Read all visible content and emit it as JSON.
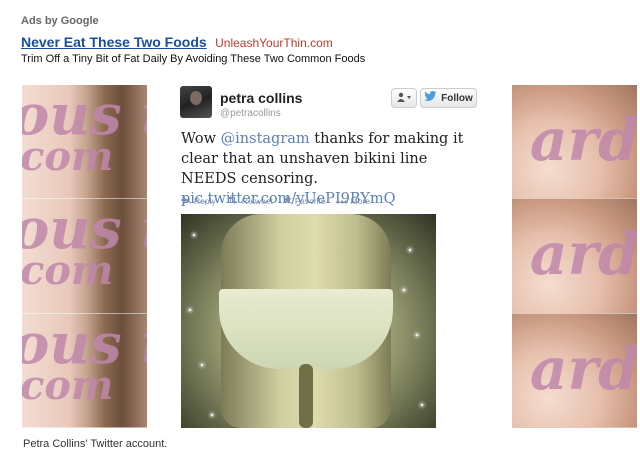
{
  "ad": {
    "label": "Ads by Google",
    "title": "Never Eat These Two Foods",
    "url": "UnleashYourThin.com",
    "description": "Trim Off a Tiny Bit of Fat Daily By Avoiding These Two Common Foods"
  },
  "side_left": {
    "overlay_line1": "ous th",
    "overlay_line2": "com"
  },
  "side_right": {
    "overlay_text": "ard"
  },
  "tweet": {
    "name": "petra collins",
    "handle": "@petracollins",
    "text_before": "Wow ",
    "mention": "@instagram",
    "text_after": " thanks for making it clear that an unshaven bikini line NEEDS censoring. ",
    "link": "pic.twitter.com/yUePI9BYmQ",
    "follow_label": "Follow",
    "reply_label": "Reply",
    "retweet_label": "Retweet",
    "favorite_label": "Favorite",
    "more_label": "More"
  },
  "caption": "Petra Collins' Twitter account.",
  "colors": {
    "ad_title": "#1a4e9c",
    "ad_url": "#c0392b",
    "tweet_link": "#5a80b8",
    "action_text": "#7a8fb6",
    "twitter_bird": "#4a9fe0"
  }
}
